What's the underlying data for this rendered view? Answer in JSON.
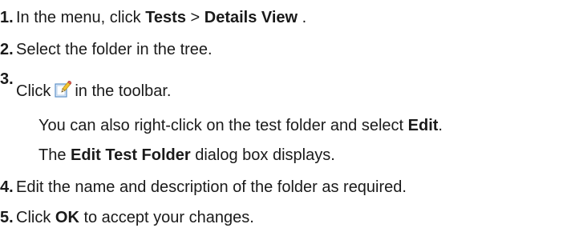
{
  "steps": [
    {
      "num": "1.",
      "pre": "In the menu, click ",
      "b1": "Tests",
      "mid": " > ",
      "b2": "Details View",
      "post": " ."
    },
    {
      "num": "2.",
      "text": "Select the folder in the tree."
    },
    {
      "num": "3.",
      "pre": "Click",
      "icon": "edit-icon",
      "post": "in the toolbar.",
      "note1_pre": "You can also right-click on the test folder and select ",
      "note1_bold": "Edit",
      "note1_post": ".",
      "note2_pre": "The ",
      "note2_bold": "Edit Test Folder",
      "note2_post": " dialog box displays."
    },
    {
      "num": "4.",
      "text": "Edit the name and description of the folder as required."
    },
    {
      "num": "5.",
      "pre": "Click ",
      "bold": "OK",
      "post": " to accept your changes."
    }
  ]
}
